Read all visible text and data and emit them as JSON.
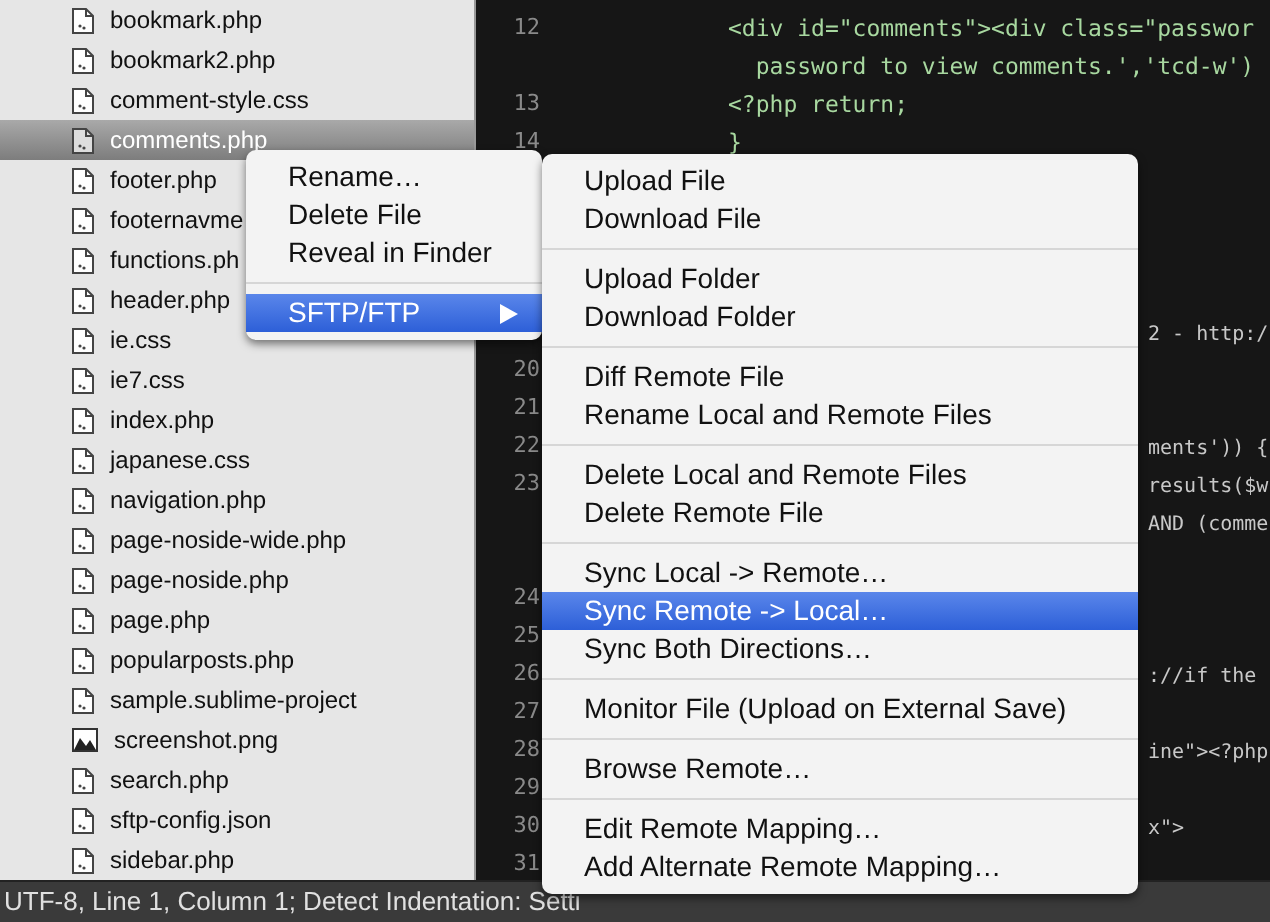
{
  "sidebar": {
    "items": [
      {
        "name": "bookmark.php",
        "kind": "file",
        "selected": false
      },
      {
        "name": "bookmark2.php",
        "kind": "file",
        "selected": false
      },
      {
        "name": "comment-style.css",
        "kind": "file",
        "selected": false
      },
      {
        "name": "comments.php",
        "kind": "file",
        "selected": true
      },
      {
        "name": "footer.php",
        "kind": "file",
        "selected": false
      },
      {
        "name": "footernavme",
        "kind": "file",
        "selected": false
      },
      {
        "name": "functions.ph",
        "kind": "file",
        "selected": false
      },
      {
        "name": "header.php",
        "kind": "file",
        "selected": false
      },
      {
        "name": "ie.css",
        "kind": "file",
        "selected": false
      },
      {
        "name": "ie7.css",
        "kind": "file",
        "selected": false
      },
      {
        "name": "index.php",
        "kind": "file",
        "selected": false
      },
      {
        "name": "japanese.css",
        "kind": "file",
        "selected": false
      },
      {
        "name": "navigation.php",
        "kind": "file",
        "selected": false
      },
      {
        "name": "page-noside-wide.php",
        "kind": "file",
        "selected": false
      },
      {
        "name": "page-noside.php",
        "kind": "file",
        "selected": false
      },
      {
        "name": "page.php",
        "kind": "file",
        "selected": false
      },
      {
        "name": "popularposts.php",
        "kind": "file",
        "selected": false
      },
      {
        "name": "sample.sublime-project",
        "kind": "file",
        "selected": false
      },
      {
        "name": "screenshot.png",
        "kind": "image",
        "selected": false
      },
      {
        "name": "search.php",
        "kind": "file",
        "selected": false
      },
      {
        "name": "sftp-config.json",
        "kind": "file",
        "selected": false
      },
      {
        "name": "sidebar.php",
        "kind": "file",
        "selected": false
      }
    ]
  },
  "editor": {
    "rows": [
      {
        "number": "12",
        "code": "<div id=\"comments\"><div class=\"passwor"
      },
      {
        "code": "  password to view comments.','tcd-w')"
      },
      {
        "number": "13",
        "code": "<?php return;"
      },
      {
        "number": "14",
        "code": "}"
      },
      {},
      {},
      {},
      {},
      {
        "tail": "2 - http:/"
      },
      {
        "number": "20"
      },
      {
        "number": "21"
      },
      {
        "number": "22",
        "tail": "ments')) {"
      },
      {
        "number": "23",
        "tail": "results($w"
      },
      {
        "tail": "AND (comme"
      },
      {},
      {
        "number": "24"
      },
      {
        "number": "25"
      },
      {
        "number": "26",
        "tail": "://if the"
      },
      {
        "number": "27"
      },
      {
        "number": "28",
        "tail": "ine\"><?php"
      },
      {
        "number": "29"
      },
      {
        "number": "30",
        "tail": "x\">"
      },
      {
        "number": "31"
      }
    ]
  },
  "context_menu": {
    "groups": [
      [
        {
          "label": "Rename…",
          "selected": false
        },
        {
          "label": "Delete File",
          "selected": false
        },
        {
          "label": "Reveal in Finder",
          "selected": false
        }
      ],
      [
        {
          "label": "SFTP/FTP",
          "selected": true,
          "submenu": true
        }
      ]
    ]
  },
  "submenu": {
    "groups": [
      [
        {
          "label": "Upload File",
          "selected": false
        },
        {
          "label": "Download File",
          "selected": false
        }
      ],
      [
        {
          "label": "Upload Folder",
          "selected": false
        },
        {
          "label": "Download Folder",
          "selected": false
        }
      ],
      [
        {
          "label": "Diff Remote File",
          "selected": false
        },
        {
          "label": "Rename Local and Remote Files",
          "selected": false
        }
      ],
      [
        {
          "label": "Delete Local and Remote Files",
          "selected": false
        },
        {
          "label": "Delete Remote File",
          "selected": false
        }
      ],
      [
        {
          "label": "Sync Local -> Remote…",
          "selected": false
        },
        {
          "label": "Sync Remote -> Local…",
          "selected": true
        },
        {
          "label": "Sync Both Directions…",
          "selected": false
        }
      ],
      [
        {
          "label": "Monitor File (Upload on External Save)",
          "selected": false
        }
      ],
      [
        {
          "label": "Browse Remote…",
          "selected": false
        }
      ],
      [
        {
          "label": "Edit Remote Mapping…",
          "selected": false
        },
        {
          "label": "Add Alternate Remote Mapping…",
          "selected": false
        }
      ]
    ]
  },
  "status_bar": {
    "text": "UTF-8, Line 1, Column 1; Detect Indentation: Setti"
  }
}
